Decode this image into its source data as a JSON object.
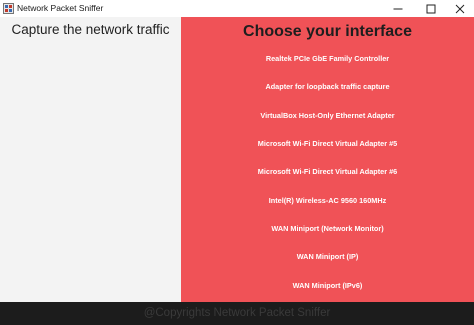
{
  "window": {
    "title": "Network Packet Sniffer",
    "icon": "sniffer-app-icon",
    "controls": [
      "minimize",
      "maximize",
      "close"
    ]
  },
  "left": {
    "heading": "Capture the network traffic"
  },
  "right": {
    "heading": "Choose your interface",
    "interfaces": [
      "Realtek PCIe GbE Family Controller",
      "Adapter for loopback traffic capture",
      "VirtualBox Host-Only Ethernet Adapter",
      "Microsoft Wi-Fi Direct Virtual Adapter #5",
      "Microsoft Wi-Fi Direct Virtual Adapter #6",
      "Intel(R) Wireless-AC 9560 160MHz",
      "WAN Miniport (Network Monitor)",
      "WAN Miniport (IP)",
      "WAN Miniport (IPv6)"
    ]
  },
  "footer": {
    "text": "@Copyrights Network Packet Sniffer"
  },
  "colors": {
    "accent": "#f05257",
    "left_bg": "#f3f3f3",
    "footer_bg": "#1c1c1c"
  }
}
